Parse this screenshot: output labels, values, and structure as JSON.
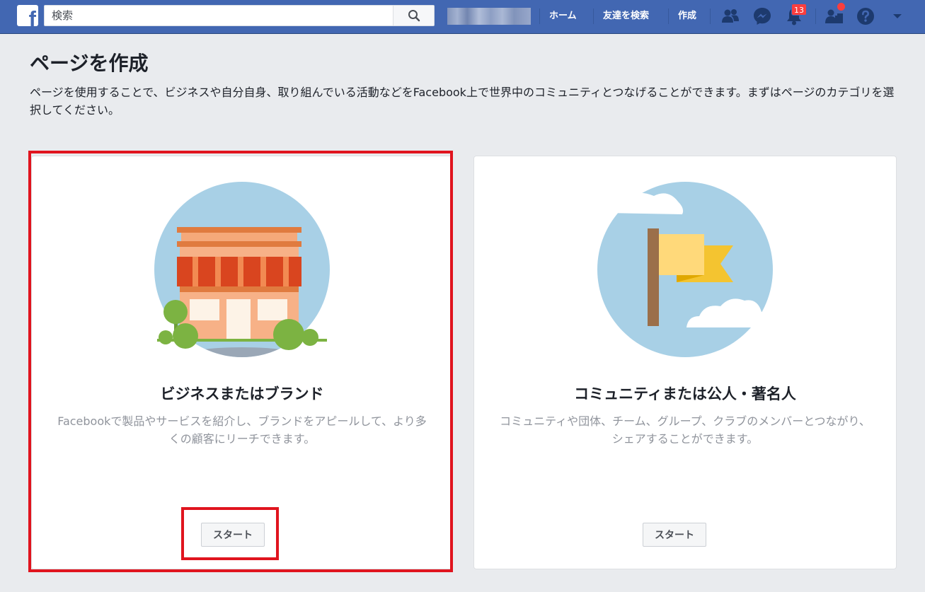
{
  "header": {
    "logo_letter": "f",
    "search": {
      "placeholder": "検索",
      "value": ""
    },
    "nav": {
      "home": "ホーム",
      "find_friends": "友達を検索",
      "create": "作成"
    },
    "notifications_count": "13"
  },
  "main": {
    "title": "ページを作成",
    "description": "ページを使用することで、ビジネスや自分自身、取り組んでいる活動などをFacebook上で世界中のコミュニティとつなげることができます。まずはページのカテゴリを選択してください。"
  },
  "cards": [
    {
      "title": "ビジネスまたはブランド",
      "description": "Facebookで製品やサービスを紹介し、ブランドをアピールして、より多くの顧客にリーチできます。",
      "button": "スタート",
      "highlighted": true
    },
    {
      "title": "コミュニティまたは公人・著名人",
      "description": "コミュニティや団体、チーム、グループ、クラブのメンバーとつながり、シェアすることができます。",
      "button": "スタート",
      "highlighted": false
    }
  ],
  "colors": {
    "brand_blue": "#4267b2",
    "highlight_red": "#e0141e",
    "badge_red": "#fa3e3e"
  },
  "icons": [
    "search-icon",
    "friends-icon",
    "messenger-icon",
    "bell-icon",
    "friend-requests-icon",
    "help-icon",
    "caret-down-icon"
  ]
}
